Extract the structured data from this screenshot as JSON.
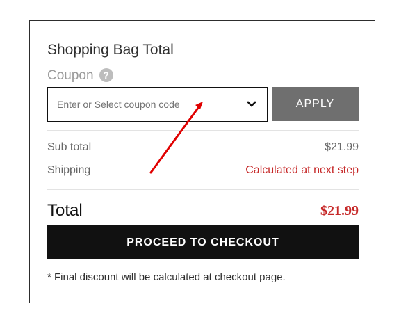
{
  "shopping_bag": {
    "title": "Shopping Bag Total",
    "coupon_label": "Coupon",
    "help_icon": "question-mark-icon",
    "coupon_placeholder": "Enter or Select coupon code",
    "coupon_dropdown_icon": "chevron-down-icon",
    "apply_label": "APPLY"
  },
  "summary": {
    "subtotal_label": "Sub total",
    "subtotal_value": "$21.99",
    "shipping_label": "Shipping",
    "shipping_value": "Calculated at next step",
    "total_label": "Total",
    "total_value": "$21.99"
  },
  "checkout": {
    "button_label": "PROCEED TO CHECKOUT",
    "note": "* Final discount will be calculated at checkout page."
  },
  "annotation": {
    "icon": "red-arrow-icon"
  },
  "colors": {
    "primary_text": "#2f2f2f",
    "muted_text": "#9a9a9a",
    "price_red": "#c62828",
    "apply_button": "#6f6f6f",
    "checkout_button": "#111111",
    "annotation_red": "#e00000"
  }
}
